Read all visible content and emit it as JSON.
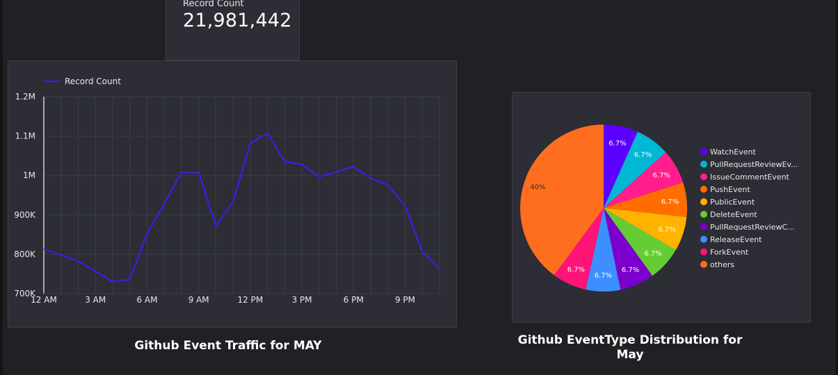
{
  "scorecard": {
    "label": "Record Count",
    "value": "21,981,442"
  },
  "line_chart_title": "Github Event Traffic for MAY",
  "pie_chart_title": "Github EventType Distribution for May",
  "colors": {
    "background": "#202124",
    "panel": "#2c2d35",
    "line": "#3b1fd6",
    "grid": "#3d3f48",
    "axis_text": "#e8e8ea"
  },
  "chart_data": [
    {
      "type": "line",
      "title": "Github Event Traffic for MAY",
      "xlabel": "",
      "ylabel": "",
      "legend": {
        "placement": "top-left",
        "entries": [
          "Record Count"
        ]
      },
      "grid": true,
      "x": [
        0,
        1,
        2,
        3,
        4,
        5,
        6,
        7,
        8,
        9,
        10,
        11,
        12,
        13,
        14,
        15,
        16,
        17,
        18,
        19,
        20,
        21,
        22,
        23
      ],
      "x_tick_values": [
        0,
        3,
        6,
        9,
        12,
        15,
        18,
        21
      ],
      "x_tick_labels": [
        "12 AM",
        "3 AM",
        "6 AM",
        "9 AM",
        "12 PM",
        "3 PM",
        "6 PM",
        "9 PM"
      ],
      "xlim": [
        0,
        23
      ],
      "ylim": [
        700000,
        1200000
      ],
      "y_tick_values": [
        700000,
        800000,
        900000,
        1000000,
        1100000,
        1200000
      ],
      "y_tick_labels": [
        "700K",
        "800K",
        "900K",
        "1M",
        "1.1M",
        "1.2M"
      ],
      "series": [
        {
          "name": "Record Count",
          "values": [
            813000,
            798000,
            782000,
            757000,
            730000,
            736000,
            852000,
            928000,
            1008000,
            1007000,
            871000,
            933000,
            1081000,
            1108000,
            1035000,
            1028000,
            997000,
            1009000,
            1022000,
            993000,
            976000,
            923000,
            806000,
            762000
          ]
        }
      ]
    },
    {
      "type": "pie",
      "title": "Github EventType Distribution for May",
      "legend": {
        "placement": "right"
      },
      "slices": [
        {
          "label": "WatchEvent",
          "value": 6.7,
          "display": "6.7%",
          "color": "#5b00ff"
        },
        {
          "label": "PullRequestReviewEv...",
          "value": 6.7,
          "display": "6.7%",
          "color": "#00b8d4"
        },
        {
          "label": "IssueCommentEvent",
          "value": 6.7,
          "display": "6.7%",
          "color": "#ff1e8c"
        },
        {
          "label": "PushEvent",
          "value": 6.7,
          "display": "6.7%",
          "color": "#ff6d00"
        },
        {
          "label": "PublicEvent",
          "value": 6.7,
          "display": "6.7%",
          "color": "#ffb300"
        },
        {
          "label": "DeleteEvent",
          "value": 6.7,
          "display": "6.7%",
          "color": "#66cc33"
        },
        {
          "label": "PullRequestReviewC...",
          "value": 6.7,
          "display": "6.7%",
          "color": "#7b00cc"
        },
        {
          "label": "ReleaseEvent",
          "value": 6.7,
          "display": "6.7%",
          "color": "#3d8fff"
        },
        {
          "label": "ForkEvent",
          "value": 6.7,
          "display": "6.7%",
          "color": "#ff1478"
        },
        {
          "label": "others",
          "value": 40,
          "display": "40%",
          "color": "#ff6e1f"
        }
      ]
    }
  ]
}
